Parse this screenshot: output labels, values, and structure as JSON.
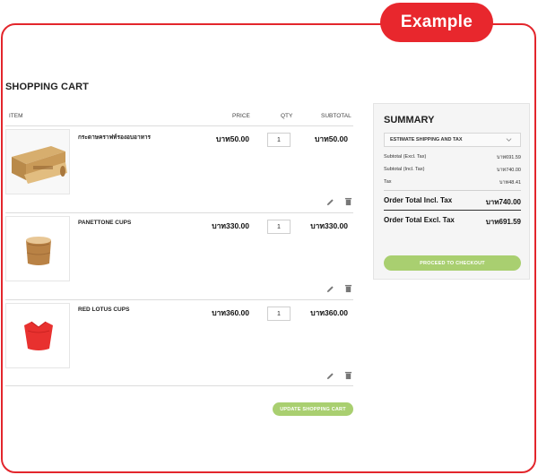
{
  "badge": "Example",
  "cart": {
    "title": "SHOPPING CART",
    "headers": {
      "item": "ITEM",
      "price": "PRICE",
      "qty": "QTY",
      "subtotal": "SUBTOTAL"
    },
    "items": [
      {
        "name": "กระดาษคราฟท์รองอบอาหาร",
        "price": "บาท50.00",
        "qty": "1",
        "subtotal": "บาท50.00",
        "image": "kraft-paper-roll"
      },
      {
        "name": "PANETTONE CUPS",
        "price": "บาท330.00",
        "qty": "1",
        "subtotal": "บาท330.00",
        "image": "panettone-cup"
      },
      {
        "name": "RED LOTUS CUPS",
        "price": "บาท360.00",
        "qty": "1",
        "subtotal": "บาท360.00",
        "image": "red-lotus-cup"
      }
    ],
    "update_label": "UPDATE SHOPPING CART"
  },
  "summary": {
    "title": "SUMMARY",
    "estimate_label": "ESTIMATE SHIPPING AND TAX",
    "lines": [
      {
        "label": "Subtotal (Excl. Tax)",
        "value": "บาท691.59"
      },
      {
        "label": "Subtotal (Incl. Tax)",
        "value": "บาท740.00"
      },
      {
        "label": "Tax",
        "value": "บาท48.41"
      }
    ],
    "total_incl": {
      "label": "Order Total Incl. Tax",
      "value": "บาท740.00"
    },
    "total_excl": {
      "label": "Order Total Excl. Tax",
      "value": "บาท691.59"
    },
    "checkout_label": "PROCEED TO CHECKOUT"
  },
  "colors": {
    "accent_red": "#e8272d",
    "button_green": "#a9cf70"
  },
  "icons": [
    "edit-icon",
    "trash-icon",
    "chevron-down-icon"
  ]
}
